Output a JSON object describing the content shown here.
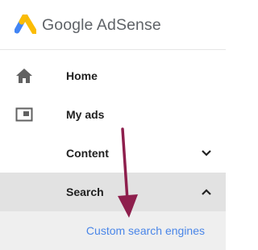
{
  "brand": {
    "name": "Google AdSense",
    "logo_colors": {
      "yellow": "#fbbc04",
      "blue": "#4285f4"
    }
  },
  "nav": {
    "items": [
      {
        "label": "Home",
        "icon": "home-icon"
      },
      {
        "label": "My ads",
        "icon": "ad-unit-icon"
      },
      {
        "label": "Content",
        "icon": "",
        "chevron": "chevron-down-icon"
      },
      {
        "label": "Search",
        "icon": "",
        "chevron": "chevron-up-icon",
        "active": true
      }
    ],
    "sub_items": [
      {
        "label": "Custom search engines"
      }
    ]
  },
  "annotation": {
    "arrow_color": "#8e1f4d"
  },
  "colors": {
    "active_bg": "#e2e2e2",
    "sub_bg": "#efefef",
    "link": "#4a86e8"
  }
}
